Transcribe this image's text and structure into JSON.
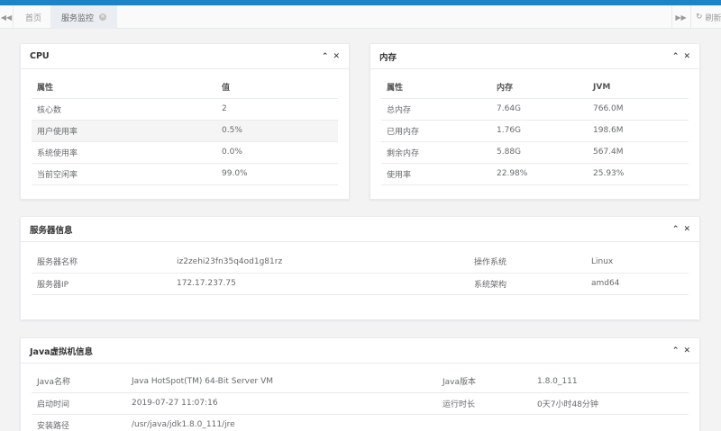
{
  "tabs": {
    "home": "首页",
    "active": "服务监控",
    "refresh": "刷新"
  },
  "cpu": {
    "title": "CPU",
    "headers": [
      "属性",
      "值"
    ],
    "rows": [
      [
        "核心数",
        "2"
      ],
      [
        "用户使用率",
        "0.5%"
      ],
      [
        "系统使用率",
        "0.0%"
      ],
      [
        "当前空闲率",
        "99.0%"
      ]
    ]
  },
  "memory": {
    "title": "内存",
    "headers": [
      "属性",
      "内存",
      "JVM"
    ],
    "rows": [
      [
        "总内存",
        "7.64G",
        "766.0M"
      ],
      [
        "已用内存",
        "1.76G",
        "198.6M"
      ],
      [
        "剩余内存",
        "5.88G",
        "567.4M"
      ],
      [
        "使用率",
        "22.98%",
        "25.93%"
      ]
    ]
  },
  "server": {
    "title": "服务器信息",
    "rows": [
      [
        "服务器名称",
        "iz2zehi23fn35q4od1g81rz",
        "操作系统",
        "Linux"
      ],
      [
        "服务器IP",
        "172.17.237.75",
        "系统架构",
        "amd64"
      ]
    ]
  },
  "jvm": {
    "title": "Java虚拟机信息",
    "rows": [
      [
        "Java名称",
        "Java HotSpot(TM) 64-Bit Server VM",
        "Java版本",
        "1.8.0_111"
      ],
      [
        "启动时间",
        "2019-07-27 11:07:16",
        "运行时长",
        "0天7小时48分钟"
      ],
      [
        "安装路径",
        "/usr/java/jdk1.8.0_111/jre",
        "",
        ""
      ]
    ]
  },
  "icons": {
    "collapse": "chevron-up-icon",
    "close": "close-icon"
  }
}
